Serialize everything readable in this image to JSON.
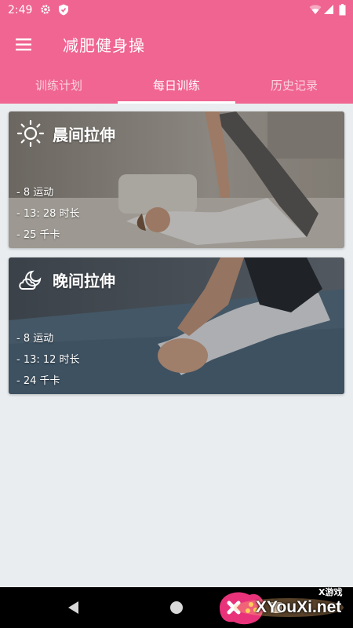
{
  "status_bar": {
    "time": "2:49",
    "icons": [
      "gear-icon",
      "shield-icon",
      "wifi-icon",
      "signal-icon",
      "battery-icon"
    ]
  },
  "app_bar": {
    "title": "减肥健身操",
    "menu_icon": "menu-icon"
  },
  "tabs": [
    {
      "label": "训练计划",
      "active": false
    },
    {
      "label": "每日训练",
      "active": true
    },
    {
      "label": "历史记录",
      "active": false
    }
  ],
  "cards": [
    {
      "title": "晨间拉伸",
      "icon": "sun-icon",
      "exercises": "- 8 运动",
      "duration": "- 13: 28 时长",
      "calories": "- 25 千卡"
    },
    {
      "title": "晚间拉伸",
      "icon": "moon-cloud-icon",
      "exercises": "- 8 运动",
      "duration": "- 13: 12 时长",
      "calories": "- 24 千卡"
    }
  ],
  "nav_bar": {
    "buttons": [
      "back-icon",
      "home-icon",
      "recents-icon"
    ]
  },
  "watermark": {
    "text": "XYouXi.net",
    "subtext": "X游戏"
  },
  "colors": {
    "primary": "#f06592",
    "background": "#e9edf0",
    "nav_bar": "#000000"
  }
}
